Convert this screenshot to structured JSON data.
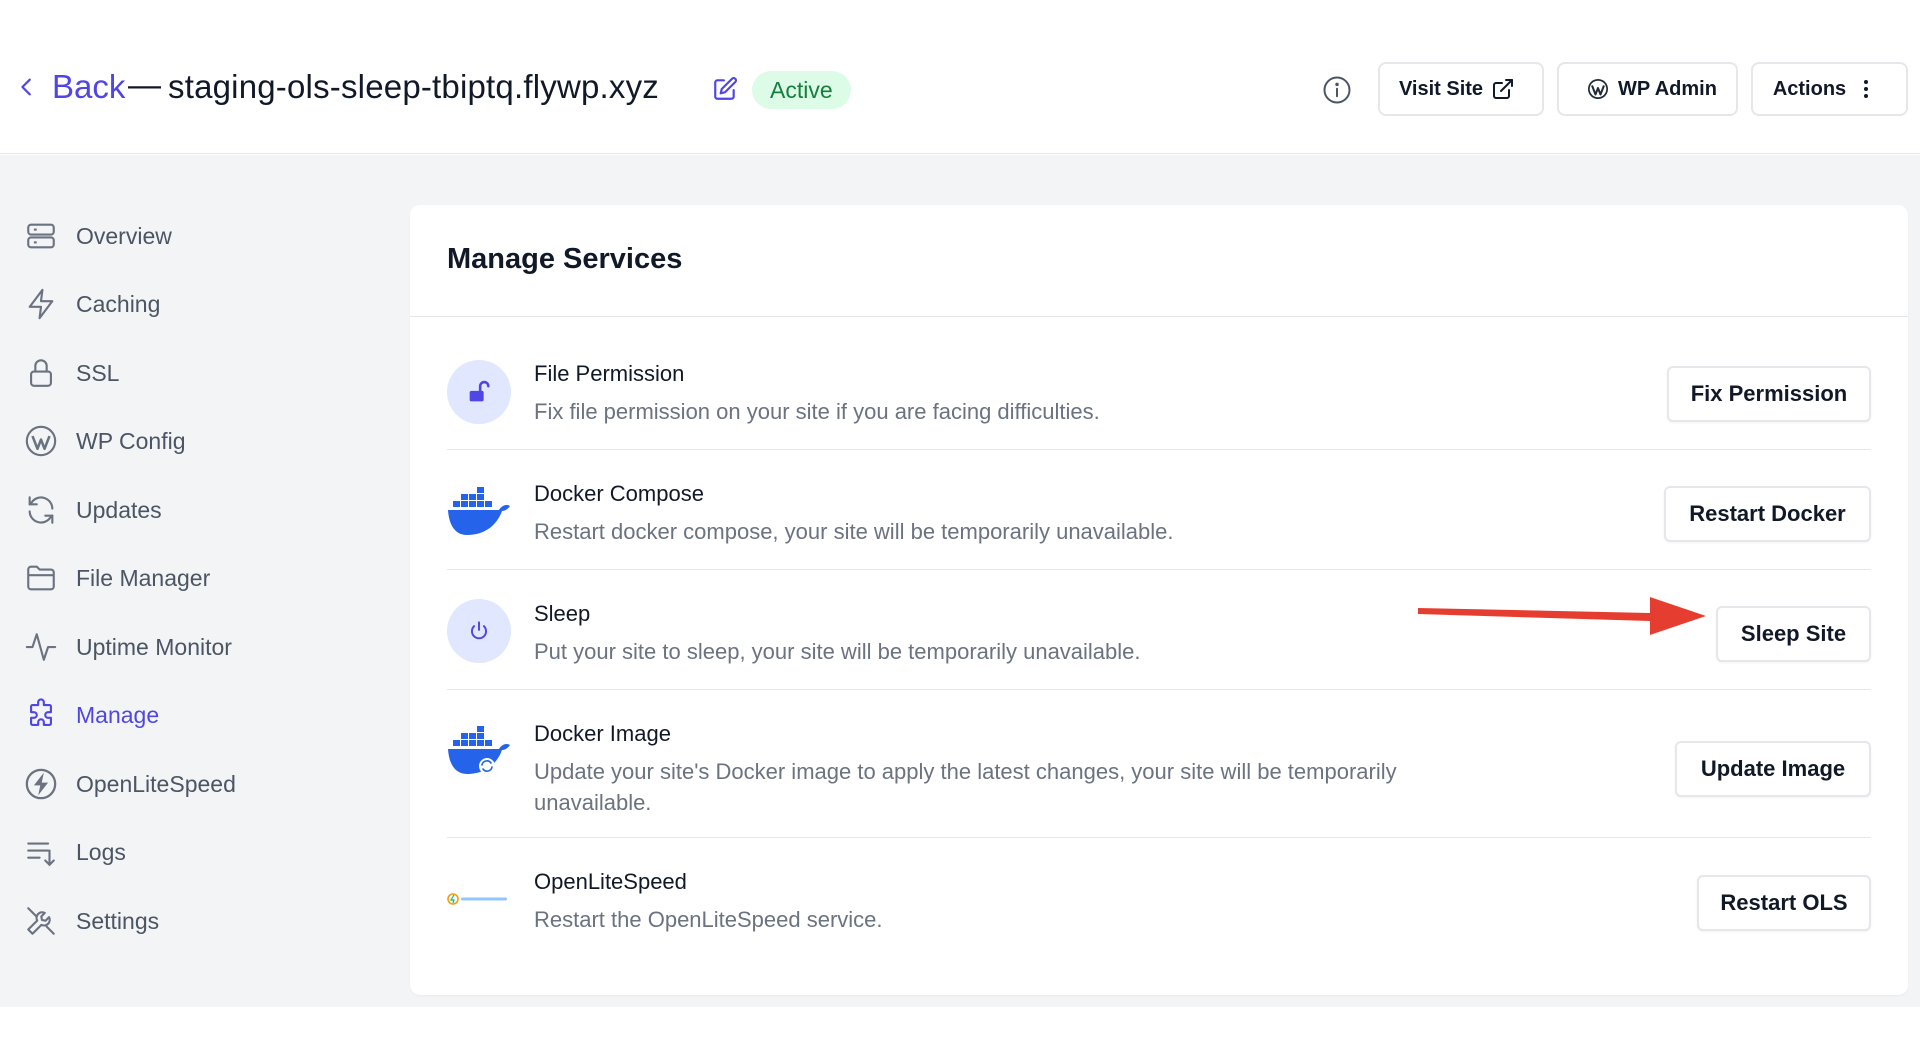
{
  "header": {
    "back_label": "Back",
    "separator": "—",
    "site_title": "staging-ols-sleep-tbiptq.flywp.xyz",
    "status_badge": "Active",
    "visit_site_label": "Visit Site",
    "wp_admin_label": "WP Admin",
    "actions_label": "Actions"
  },
  "sidebar": {
    "items": [
      {
        "label": "Overview",
        "icon": "server-icon"
      },
      {
        "label": "Caching",
        "icon": "bolt-icon"
      },
      {
        "label": "SSL",
        "icon": "lock-icon"
      },
      {
        "label": "WP Config",
        "icon": "wordpress-icon"
      },
      {
        "label": "Updates",
        "icon": "refresh-icon"
      },
      {
        "label": "File Manager",
        "icon": "folder-icon"
      },
      {
        "label": "Uptime Monitor",
        "icon": "pulse-icon"
      },
      {
        "label": "Manage",
        "icon": "puzzle-icon",
        "active": true
      },
      {
        "label": "OpenLiteSpeed",
        "icon": "openlitespeed-icon"
      },
      {
        "label": "Logs",
        "icon": "list-icon"
      },
      {
        "label": "Settings",
        "icon": "tools-icon"
      }
    ]
  },
  "main": {
    "title": "Manage Services",
    "services": [
      {
        "name": "File Permission",
        "description": "Fix file permission on your site if you are facing difficulties.",
        "button": "Fix Permission",
        "icon": "unlock-icon"
      },
      {
        "name": "Docker Compose",
        "description": "Restart docker compose, your site will be temporarily unavailable.",
        "button": "Restart Docker",
        "icon": "docker-icon"
      },
      {
        "name": "Sleep",
        "description": "Put your site to sleep, your site will be temporarily unavailable.",
        "button": "Sleep Site",
        "icon": "power-icon"
      },
      {
        "name": "Docker Image",
        "description": "Update your site's Docker image to apply the latest changes, your site will be temporarily unavailable.",
        "button": "Update Image",
        "icon": "docker-refresh-icon"
      },
      {
        "name": "OpenLiteSpeed",
        "description": "Restart the OpenLiteSpeed service.",
        "button": "Restart OLS",
        "icon": "openlitespeed-logo"
      }
    ]
  },
  "colors": {
    "accent": "#4f46e5",
    "badge_bg": "#dcfce7",
    "badge_text": "#15803d",
    "arrow": "#e53e30"
  }
}
